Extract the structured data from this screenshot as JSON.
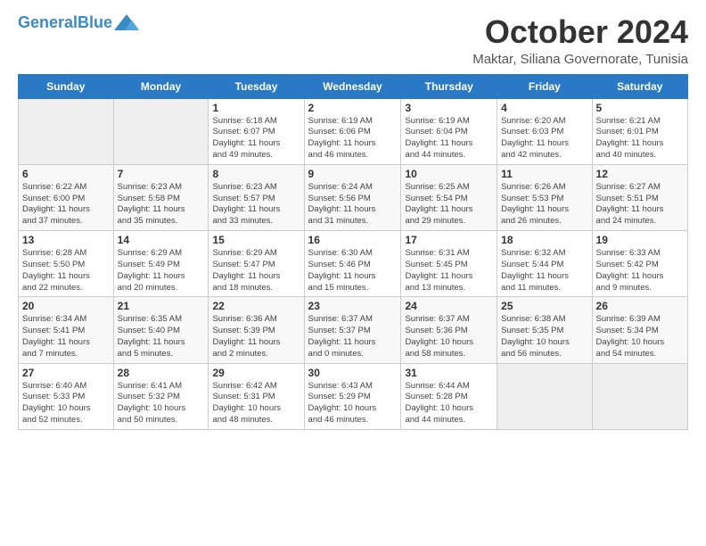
{
  "logo": {
    "general": "General",
    "blue": "Blue",
    "tagline": "Blue"
  },
  "title": "October 2024",
  "location": "Maktar, Siliana Governorate, Tunisia",
  "headers": [
    "Sunday",
    "Monday",
    "Tuesday",
    "Wednesday",
    "Thursday",
    "Friday",
    "Saturday"
  ],
  "weeks": [
    [
      {
        "day": "",
        "info": ""
      },
      {
        "day": "",
        "info": ""
      },
      {
        "day": "1",
        "info": "Sunrise: 6:18 AM\nSunset: 6:07 PM\nDaylight: 11 hours\nand 49 minutes."
      },
      {
        "day": "2",
        "info": "Sunrise: 6:19 AM\nSunset: 6:06 PM\nDaylight: 11 hours\nand 46 minutes."
      },
      {
        "day": "3",
        "info": "Sunrise: 6:19 AM\nSunset: 6:04 PM\nDaylight: 11 hours\nand 44 minutes."
      },
      {
        "day": "4",
        "info": "Sunrise: 6:20 AM\nSunset: 6:03 PM\nDaylight: 11 hours\nand 42 minutes."
      },
      {
        "day": "5",
        "info": "Sunrise: 6:21 AM\nSunset: 6:01 PM\nDaylight: 11 hours\nand 40 minutes."
      }
    ],
    [
      {
        "day": "6",
        "info": "Sunrise: 6:22 AM\nSunset: 6:00 PM\nDaylight: 11 hours\nand 37 minutes."
      },
      {
        "day": "7",
        "info": "Sunrise: 6:23 AM\nSunset: 5:58 PM\nDaylight: 11 hours\nand 35 minutes."
      },
      {
        "day": "8",
        "info": "Sunrise: 6:23 AM\nSunset: 5:57 PM\nDaylight: 11 hours\nand 33 minutes."
      },
      {
        "day": "9",
        "info": "Sunrise: 6:24 AM\nSunset: 5:56 PM\nDaylight: 11 hours\nand 31 minutes."
      },
      {
        "day": "10",
        "info": "Sunrise: 6:25 AM\nSunset: 5:54 PM\nDaylight: 11 hours\nand 29 minutes."
      },
      {
        "day": "11",
        "info": "Sunrise: 6:26 AM\nSunset: 5:53 PM\nDaylight: 11 hours\nand 26 minutes."
      },
      {
        "day": "12",
        "info": "Sunrise: 6:27 AM\nSunset: 5:51 PM\nDaylight: 11 hours\nand 24 minutes."
      }
    ],
    [
      {
        "day": "13",
        "info": "Sunrise: 6:28 AM\nSunset: 5:50 PM\nDaylight: 11 hours\nand 22 minutes."
      },
      {
        "day": "14",
        "info": "Sunrise: 6:29 AM\nSunset: 5:49 PM\nDaylight: 11 hours\nand 20 minutes."
      },
      {
        "day": "15",
        "info": "Sunrise: 6:29 AM\nSunset: 5:47 PM\nDaylight: 11 hours\nand 18 minutes."
      },
      {
        "day": "16",
        "info": "Sunrise: 6:30 AM\nSunset: 5:46 PM\nDaylight: 11 hours\nand 15 minutes."
      },
      {
        "day": "17",
        "info": "Sunrise: 6:31 AM\nSunset: 5:45 PM\nDaylight: 11 hours\nand 13 minutes."
      },
      {
        "day": "18",
        "info": "Sunrise: 6:32 AM\nSunset: 5:44 PM\nDaylight: 11 hours\nand 11 minutes."
      },
      {
        "day": "19",
        "info": "Sunrise: 6:33 AM\nSunset: 5:42 PM\nDaylight: 11 hours\nand 9 minutes."
      }
    ],
    [
      {
        "day": "20",
        "info": "Sunrise: 6:34 AM\nSunset: 5:41 PM\nDaylight: 11 hours\nand 7 minutes."
      },
      {
        "day": "21",
        "info": "Sunrise: 6:35 AM\nSunset: 5:40 PM\nDaylight: 11 hours\nand 5 minutes."
      },
      {
        "day": "22",
        "info": "Sunrise: 6:36 AM\nSunset: 5:39 PM\nDaylight: 11 hours\nand 2 minutes."
      },
      {
        "day": "23",
        "info": "Sunrise: 6:37 AM\nSunset: 5:37 PM\nDaylight: 11 hours\nand 0 minutes."
      },
      {
        "day": "24",
        "info": "Sunrise: 6:37 AM\nSunset: 5:36 PM\nDaylight: 10 hours\nand 58 minutes."
      },
      {
        "day": "25",
        "info": "Sunrise: 6:38 AM\nSunset: 5:35 PM\nDaylight: 10 hours\nand 56 minutes."
      },
      {
        "day": "26",
        "info": "Sunrise: 6:39 AM\nSunset: 5:34 PM\nDaylight: 10 hours\nand 54 minutes."
      }
    ],
    [
      {
        "day": "27",
        "info": "Sunrise: 6:40 AM\nSunset: 5:33 PM\nDaylight: 10 hours\nand 52 minutes."
      },
      {
        "day": "28",
        "info": "Sunrise: 6:41 AM\nSunset: 5:32 PM\nDaylight: 10 hours\nand 50 minutes."
      },
      {
        "day": "29",
        "info": "Sunrise: 6:42 AM\nSunset: 5:31 PM\nDaylight: 10 hours\nand 48 minutes."
      },
      {
        "day": "30",
        "info": "Sunrise: 6:43 AM\nSunset: 5:29 PM\nDaylight: 10 hours\nand 46 minutes."
      },
      {
        "day": "31",
        "info": "Sunrise: 6:44 AM\nSunset: 5:28 PM\nDaylight: 10 hours\nand 44 minutes."
      },
      {
        "day": "",
        "info": ""
      },
      {
        "day": "",
        "info": ""
      }
    ]
  ]
}
